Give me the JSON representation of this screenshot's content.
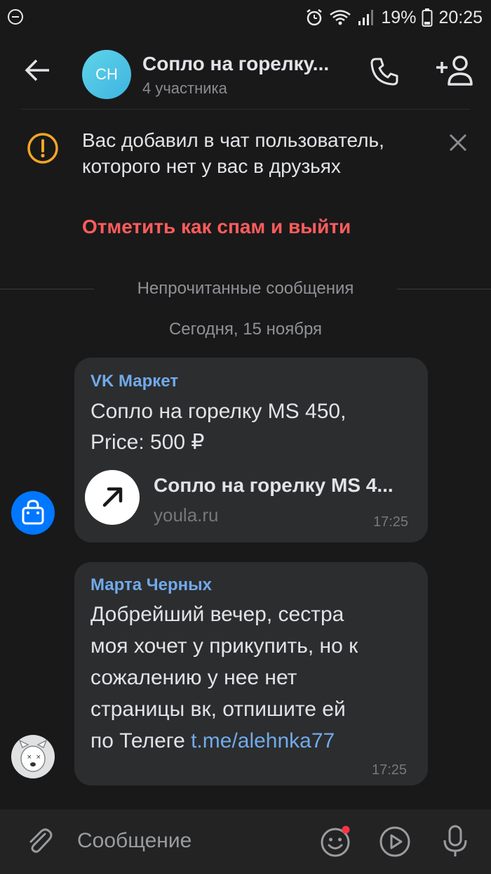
{
  "status_bar": {
    "battery": "19%",
    "time": "20:25",
    "icons": [
      "minus-circle-icon",
      "alarm-icon",
      "wifi-icon",
      "signal-icon",
      "battery-icon"
    ]
  },
  "header": {
    "avatar_initials": "CH",
    "title": "Сопло на горелку...",
    "subtitle": "4 участника"
  },
  "notice": {
    "text": "Вас добавил в чат пользователь, которого нет у вас в друзьях",
    "action": "Отметить как спам и выйти"
  },
  "separators": {
    "unread": "Непрочитанные сообщения",
    "date": "Сегодня, 15 ноября"
  },
  "messages": [
    {
      "sender": "VK Маркет",
      "text_line1": "Сопло на горелку MS 450,",
      "text_line2": "Price: 500 ₽",
      "link_title": "Сопло на горелку MS 4...",
      "link_domain": "youla.ru",
      "time": "17:25"
    },
    {
      "sender": "Марта Черных",
      "lines": [
        "Добрейший вечер, сестра",
        "моя хочет у прикупить, но к",
        "сожалению у нее нет",
        "страницы вк, отпишите ей"
      ],
      "last_prefix": "по Телеге ",
      "link": "t.me/alehnka77",
      "time": "17:25"
    }
  ],
  "input": {
    "placeholder": "Сообщение"
  },
  "colors": {
    "background": "#19191a",
    "bubble": "#2c2d2e",
    "accent": "#71aaeb",
    "danger": "#ff5c5c"
  }
}
